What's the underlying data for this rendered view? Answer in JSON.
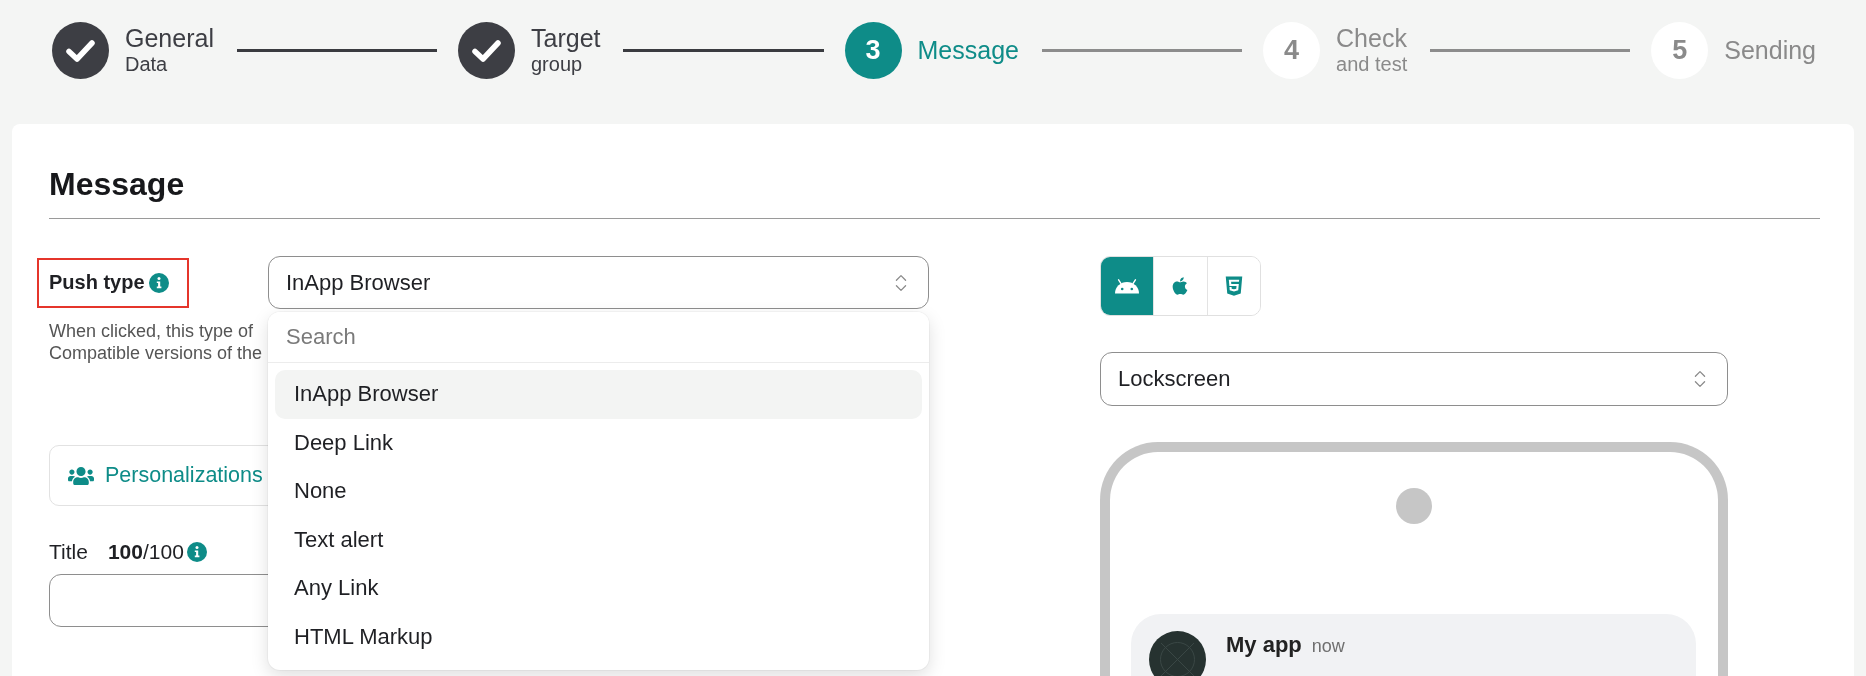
{
  "stepper": {
    "steps": [
      {
        "title": "General",
        "subtitle": "Data",
        "completed": true,
        "selected": false
      },
      {
        "title": "Target",
        "subtitle": "group",
        "completed": true,
        "selected": false
      },
      {
        "number": "3",
        "title": "Message",
        "completed": false,
        "selected": true
      },
      {
        "number": "4",
        "title": "Check",
        "subtitle": "and test",
        "completed": false,
        "selected": false
      },
      {
        "number": "5",
        "title": "Sending",
        "completed": false,
        "selected": false
      }
    ]
  },
  "section": {
    "title": "Message"
  },
  "push_type": {
    "label": "Push type",
    "highlighted": true,
    "select": {
      "value": "InApp Browser",
      "expanded": true
    },
    "description": [
      "When clicked, this type of",
      "Compatible versions of the"
    ],
    "dropdown": {
      "search_placeholder": "Search",
      "options": [
        {
          "label": "InApp Browser",
          "selected": true
        },
        {
          "label": "Deep Link",
          "selected": false
        },
        {
          "label": "None",
          "selected": false
        },
        {
          "label": "Text alert",
          "selected": false
        },
        {
          "label": "Any Link",
          "selected": false
        },
        {
          "label": "HTML Markup",
          "selected": false
        }
      ]
    }
  },
  "personalizations_button": {
    "label": "Personalizations"
  },
  "title_field": {
    "label": "Title",
    "counter": "**100**/100"
  },
  "preview": {
    "platforms": [
      {
        "kind": "android",
        "selected": true
      },
      {
        "kind": "apple",
        "selected": false
      },
      {
        "kind": "html5",
        "selected": false
      }
    ],
    "view_select": {
      "value": "Lockscreen"
    },
    "notification": {
      "app_name": "My app",
      "time": "now"
    }
  }
}
